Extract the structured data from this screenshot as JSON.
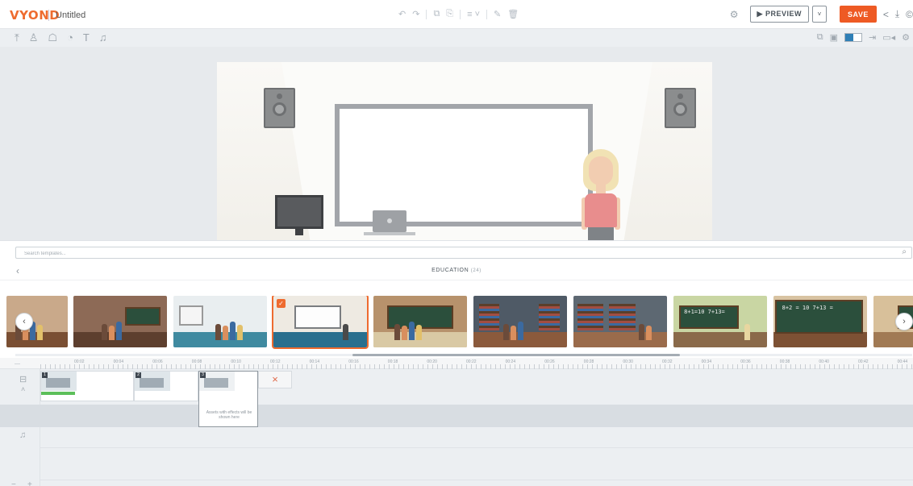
{
  "app": {
    "logo": "VYOND",
    "title": "Untitled"
  },
  "topbar": {
    "icons": [
      "undo-icon",
      "redo-icon",
      "copy-icon",
      "paste-icon",
      "layers-icon",
      "wand-icon",
      "trash-icon"
    ],
    "preview_label": "▶ PREVIEW",
    "save_label": "SAVE"
  },
  "asset_toolbar": {
    "left_icons": [
      "upload-icon",
      "character-icon",
      "props-icon",
      "chart-icon",
      "text-icon",
      "audio-icon"
    ]
  },
  "stage": {},
  "templates": {
    "search_placeholder": "Search templates...",
    "category": "EDUCATION",
    "count": "(24)",
    "items": [
      {
        "name": "template-classroom-students",
        "selected": false
      },
      {
        "name": "template-lecture-hall",
        "selected": false
      },
      {
        "name": "template-science-class",
        "selected": false
      },
      {
        "name": "template-whiteboard-room",
        "selected": true
      },
      {
        "name": "template-chalkboard-class",
        "selected": false
      },
      {
        "name": "template-library-study",
        "selected": false
      },
      {
        "name": "template-library-hall",
        "selected": false
      },
      {
        "name": "template-math-board",
        "selected": false,
        "board_text": "8+1=10 7+13="
      },
      {
        "name": "template-math-board-2",
        "selected": false,
        "board_text": "8+2 = 10  7+13 ="
      },
      {
        "name": "template-classroom-teacher",
        "selected": false
      }
    ]
  },
  "timeline": {
    "ruler": [
      "00:02",
      "00:04",
      "00:06",
      "00:08",
      "00:10",
      "00:12",
      "00:14",
      "00:16",
      "00:18",
      "00:20",
      "00:22",
      "00:24",
      "00:26",
      "00:28",
      "00:30",
      "00:32",
      "00:34",
      "00:36",
      "00:38",
      "00:40",
      "00:42",
      "00:44"
    ],
    "scenes": [
      {
        "number": "1"
      },
      {
        "number": "2"
      },
      {
        "number": "3"
      }
    ],
    "effects_note": "Assets with effects will be shown here",
    "add_symbol": "×"
  }
}
